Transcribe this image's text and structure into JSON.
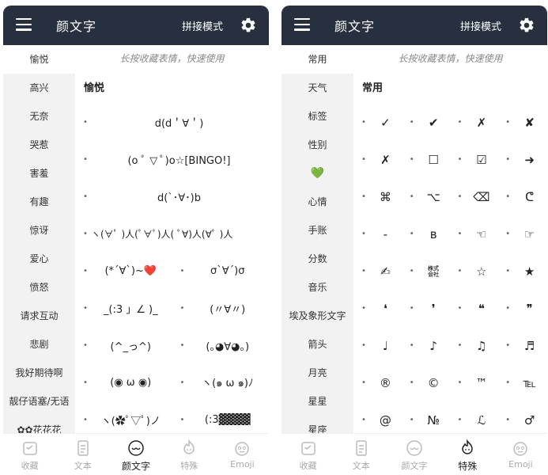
{
  "app": {
    "title": "颜文字",
    "mode_button": "拼接模式",
    "hint": "长按收藏表情，快速使用",
    "accent": "#283040"
  },
  "left": {
    "sidebar": [
      "愉悦",
      "高兴",
      "无奈",
      "哭惹",
      "害羞",
      "有趣",
      "惊讶",
      "爱心",
      "愤怒",
      "请求互动",
      "悲剧",
      "我好期待啊",
      "靓仔语塞/无语",
      "✿✿花花花"
    ],
    "section_title": "愉悦",
    "rows": [
      [
        "d(d＇∀＇)"
      ],
      [
        "(o ﾟ ▽ ﾟ)o☆[BINGO!]"
      ],
      [
        "d(`･∀･)b"
      ],
      [
        "ヽ(∀ﾟ )人(ﾟ∀ﾟ)人( ﾟ∀)人(∀ﾟ )人"
      ],
      [
        "(*´∀`)~❤️",
        "σ`∀´)σ"
      ],
      [
        "_(:3 」∠ )_",
        "(〃∀〃)"
      ],
      [
        "(^_っ^)",
        "(｡◕∀◕｡)"
      ],
      [
        "(◉ ω ◉)",
        "ヽ(๑ ω ๑)ﾉ"
      ],
      [
        "ヽ(✿ﾟ▽ﾟ)ノ",
        "(:3▓▓▓▓"
      ]
    ],
    "nav": [
      "收藏",
      "文本",
      "颜文字",
      "特殊",
      "Emoji"
    ],
    "active_nav": 2
  },
  "right": {
    "sidebar": [
      "常用",
      "天气",
      "标签",
      "性别",
      "💚",
      "心情",
      "手账",
      "分数",
      "音乐",
      "埃及象形文字",
      "箭头",
      "月亮",
      "星星",
      "星座"
    ],
    "section_title": "常用",
    "rows": [
      [
        "✓",
        "✔",
        "✗",
        "✘"
      ],
      [
        "✗",
        "☐",
        "☑",
        "➜"
      ],
      [
        "⌘",
        "⌥",
        "⌫",
        "ᕦ"
      ],
      [
        "-",
        "ʙ",
        "☜",
        "☞"
      ],
      [
        "✍",
        "㍿",
        "☆",
        "★"
      ],
      [
        "❛",
        "❜",
        "❝",
        "❞"
      ],
      [
        "♩",
        "♪",
        "♫",
        "♬"
      ],
      [
        "®",
        "©",
        "™",
        "℡"
      ],
      [
        "@",
        "№",
        "ℒ",
        "♂"
      ]
    ],
    "nav": [
      "收藏",
      "文本",
      "颜文字",
      "特殊",
      "Emoji"
    ],
    "active_nav": 3
  }
}
